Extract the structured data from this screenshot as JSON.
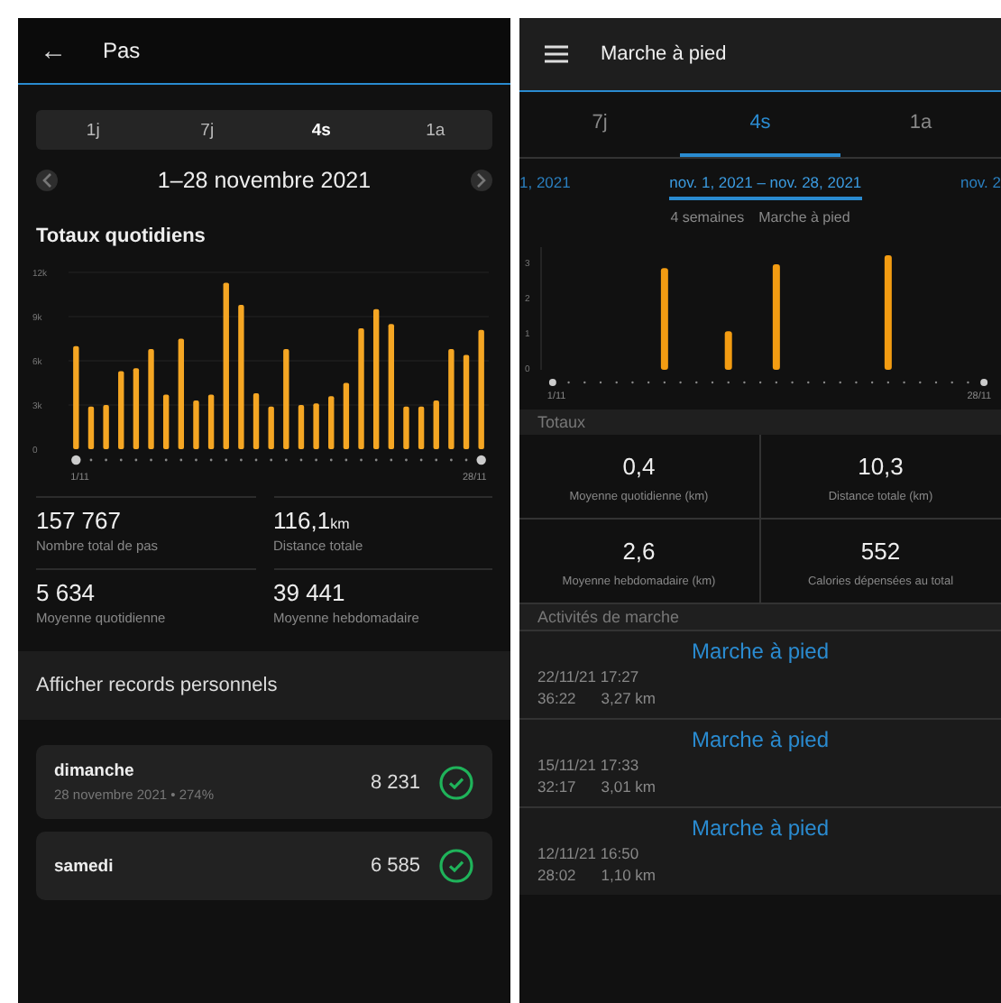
{
  "steps_screen": {
    "header": {
      "back_icon": "←",
      "title": "Pas"
    },
    "period_tabs": [
      {
        "label": "1j",
        "selected": false
      },
      {
        "label": "7j",
        "selected": false
      },
      {
        "label": "4s",
        "selected": true
      },
      {
        "label": "1a",
        "selected": false
      }
    ],
    "date_range": "1–28 novembre 2021",
    "section_title": "Totaux quotidiens",
    "chart_data": {
      "type": "bar",
      "grid": true,
      "categories": [
        "1/11",
        null,
        null,
        null,
        null,
        null,
        null,
        null,
        null,
        null,
        null,
        null,
        null,
        null,
        null,
        null,
        null,
        null,
        null,
        null,
        null,
        null,
        null,
        null,
        null,
        null,
        null,
        "28/11"
      ],
      "series": [
        {
          "color": "#f5a623",
          "values": [
            7000,
            2900,
            3000,
            5300,
            5500,
            6800,
            3700,
            7500,
            3300,
            3700,
            11300,
            9800,
            3800,
            2900,
            6800,
            3000,
            3100,
            3600,
            4500,
            8200,
            9500,
            8500,
            2900,
            2900,
            3300,
            6800,
            6400,
            8100
          ]
        }
      ],
      "ylim": [
        0,
        12000
      ],
      "yticks": [
        {
          "value": 0,
          "label": "0"
        },
        {
          "value": 3000,
          "label": "3k"
        },
        {
          "value": 6000,
          "label": "6k"
        },
        {
          "value": 9000,
          "label": "9k"
        },
        {
          "value": 12000,
          "label": "12k"
        }
      ]
    },
    "stats": [
      {
        "value": "157 767",
        "label": "Nombre total de pas"
      },
      {
        "value": "116,1",
        "unit": "km",
        "label": "Distance totale"
      },
      {
        "value": "5 634",
        "label": "Moyenne quotidienne"
      },
      {
        "value": "39 441",
        "label": "Moyenne hebdomadaire"
      }
    ],
    "records_link": "Afficher records personnels",
    "records": [
      {
        "day": "dimanche",
        "detail": "28 novembre 2021 • 274%",
        "value": "8 231"
      },
      {
        "day": "samedi",
        "value": "6 585"
      }
    ]
  },
  "walking_screen": {
    "header": {
      "title": "Marche à pied"
    },
    "tabs": [
      {
        "label": "7j",
        "selected": false
      },
      {
        "label": "4s",
        "selected": true
      },
      {
        "label": "1a",
        "selected": false
      }
    ],
    "date_carousel": {
      "previous": "1, 2021",
      "current": "nov. 1, 2021 – nov. 28, 2021",
      "next": "nov. 2"
    },
    "subtitle": [
      "4 semaines",
      "Marche à pied"
    ],
    "chart_data": {
      "type": "bar",
      "categories": [
        "1/11",
        null,
        null,
        null,
        null,
        null,
        null,
        null,
        null,
        null,
        null,
        null,
        null,
        null,
        null,
        null,
        null,
        null,
        null,
        null,
        null,
        null,
        null,
        null,
        null,
        null,
        null,
        "28/11"
      ],
      "series": [
        {
          "color": "#f39c12",
          "values": [
            null,
            null,
            null,
            null,
            null,
            null,
            null,
            2.9,
            null,
            null,
            null,
            1.1,
            null,
            null,
            3.01,
            null,
            null,
            null,
            null,
            null,
            null,
            3.27,
            null,
            null,
            null,
            null,
            null,
            null
          ]
        }
      ],
      "ylim": [
        0,
        3.5
      ],
      "yticks": [
        {
          "value": 0,
          "label": "0"
        },
        {
          "value": 1,
          "label": "1"
        },
        {
          "value": 2,
          "label": "2"
        },
        {
          "value": 3,
          "label": "3"
        }
      ]
    },
    "totals_title": "Totaux",
    "totals": [
      {
        "value": "0,4",
        "label": "Moyenne quotidienne (km)"
      },
      {
        "value": "10,3",
        "label": "Distance totale (km)"
      },
      {
        "value": "2,6",
        "label": "Moyenne hebdomadaire (km)"
      },
      {
        "value": "552",
        "label": "Calories dépensées au total"
      }
    ],
    "activities_title": "Activités de marche",
    "activities": [
      {
        "title": "Marche à pied",
        "datetime": "22/11/21 17:27",
        "duration": "36:22",
        "distance": "3,27 km"
      },
      {
        "title": "Marche à pied",
        "datetime": "15/11/21 17:33",
        "duration": "32:17",
        "distance": "3,01 km"
      },
      {
        "title": "Marche à pied",
        "datetime": "12/11/21 16:50",
        "duration": "28:02",
        "distance": "1,10 km"
      }
    ]
  }
}
